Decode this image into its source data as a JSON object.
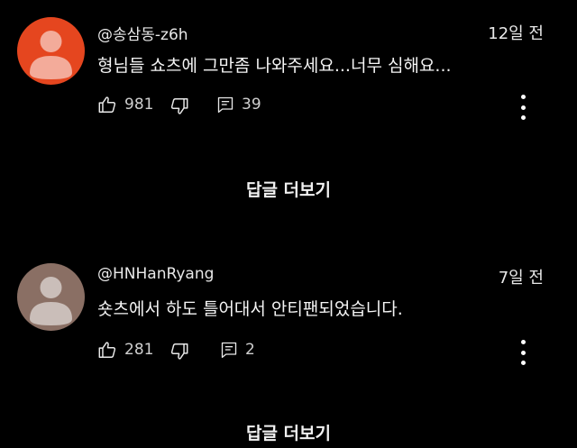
{
  "comments": [
    {
      "handle": "@송삼동-z6h",
      "time": "12일 전",
      "text": "형님들 쇼츠에 그만좀 나와주세요...너무 심해요...",
      "likes": "981",
      "replies": "39",
      "avatar_color": "#e5461f",
      "more_replies_label": "답글 더보기"
    },
    {
      "handle": "@HNHanRyang",
      "time": "7일 전",
      "text": "숏츠에서 하도 틀어대서 안티팬되었습니다.",
      "likes": "281",
      "replies": "2",
      "avatar_color": "#8a6f64",
      "more_replies_label": "답글 더보기"
    }
  ],
  "icons": {
    "like": "thumbs-up-icon",
    "dislike": "thumbs-down-icon",
    "reply": "comment-icon",
    "more": "more-vertical-icon"
  }
}
